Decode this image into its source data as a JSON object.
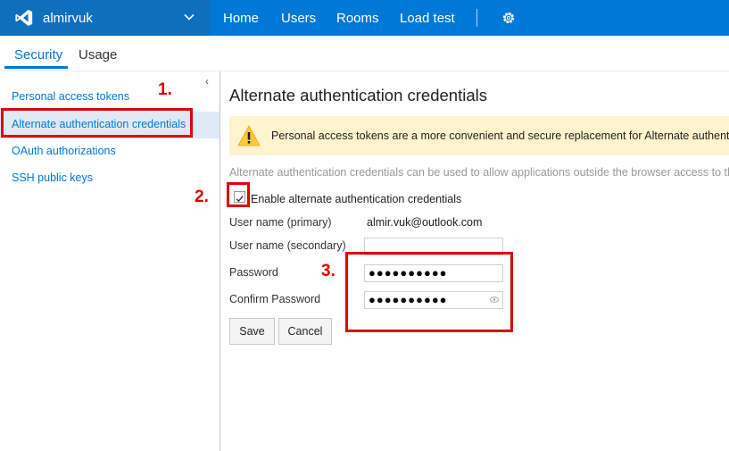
{
  "header": {
    "account_name": "almirvuk",
    "nav": [
      "Home",
      "Users",
      "Rooms",
      "Load test"
    ],
    "brand_color": "#0078d7"
  },
  "tabs": {
    "items": [
      "Security",
      "Usage"
    ],
    "active": "Security"
  },
  "sidebar": {
    "collapse_glyph": "‹",
    "items": [
      "Personal access tokens",
      "Alternate authentication credentials",
      "OAuth authorizations",
      "SSH public keys"
    ],
    "selected": "Alternate authentication credentials"
  },
  "main": {
    "title": "Alternate authentication credentials",
    "warning": "Personal access tokens are a more convenient and secure replacement for Alternate authenticatio",
    "description": "Alternate authentication credentials can be used to allow applications outside the browser access to the re",
    "enable_label": "Enable alternate authentication credentials",
    "enable_checked": true,
    "fields": {
      "primary_label": "User name (primary)",
      "primary_value": "almir.vuk@outlook.com",
      "secondary_label": "User name (secondary)",
      "secondary_value": "",
      "password_label": "Password",
      "password_value": "●●●●●●●●●●",
      "confirm_label": "Confirm Password",
      "confirm_value": "●●●●●●●●●●"
    },
    "save_label": "Save",
    "cancel_label": "Cancel"
  },
  "annotations": {
    "step1": "1.",
    "step2": "2.",
    "step3": "3.",
    "color": "#e00000"
  }
}
